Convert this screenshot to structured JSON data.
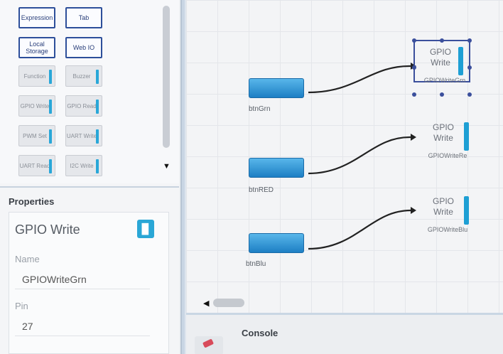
{
  "palette": {
    "tiles": [
      {
        "label": "Expression"
      },
      {
        "label": "Tab"
      },
      {
        "label": "Local Storage"
      },
      {
        "label": "Web IO"
      },
      {
        "label": "Function"
      },
      {
        "label": "Buzzer"
      },
      {
        "label": "GPIO Write"
      },
      {
        "label": "GPIO Read"
      },
      {
        "label": "PWM Set"
      },
      {
        "label": "UART Write"
      },
      {
        "label": "UART Read"
      },
      {
        "label": "I2C Write"
      }
    ],
    "scroll_down": "▼"
  },
  "properties": {
    "title": "Properties",
    "component": "GPIO Write",
    "name_label": "Name",
    "name_value": "GPIOWriteGrn",
    "pin_label": "Pin",
    "pin_value": "27"
  },
  "canvas": {
    "buttons": [
      {
        "label": "btnGrn"
      },
      {
        "label": "btnRED"
      },
      {
        "label": "btnBlu"
      }
    ],
    "gpio_blocks": [
      {
        "title": "GPIO Write",
        "name": "GPIOWriteGrn",
        "selected": true
      },
      {
        "title": "GPIO Write",
        "name": "GPIOWriteRe"
      },
      {
        "title": "GPIO Write",
        "name": "GPIOWriteBlu"
      }
    ],
    "hscroll_left": "◀"
  },
  "console": {
    "title": "Console"
  },
  "colors": {
    "accent": "#1e9fd4",
    "selection": "#3b4f9c",
    "wire": "#222222"
  }
}
